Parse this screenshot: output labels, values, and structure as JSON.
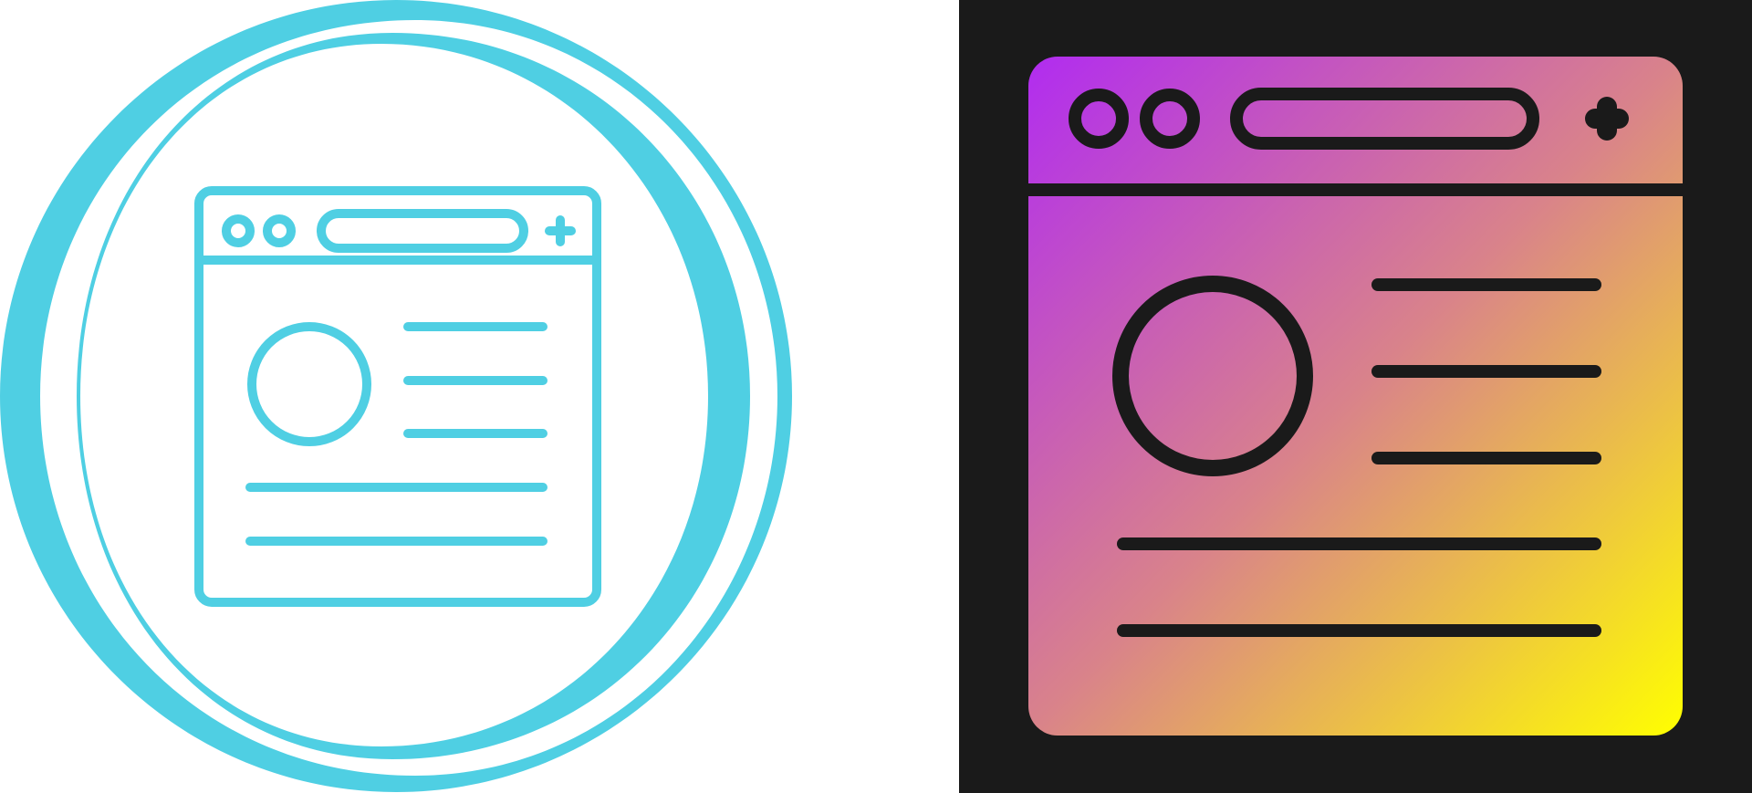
{
  "icons": {
    "left": {
      "name": "browser-window-line-icon",
      "style": "outline",
      "colors": {
        "stroke": "#4fcfe3",
        "background": "#ffffff"
      }
    },
    "right": {
      "name": "browser-window-gradient-icon",
      "style": "gradient-filled",
      "colors": {
        "background": "#1a1a1a",
        "stroke": "#1a1a1a",
        "gradient_start": "#b12cf0",
        "gradient_mid": "#d9838a",
        "gradient_end": "#ffff00"
      }
    }
  }
}
